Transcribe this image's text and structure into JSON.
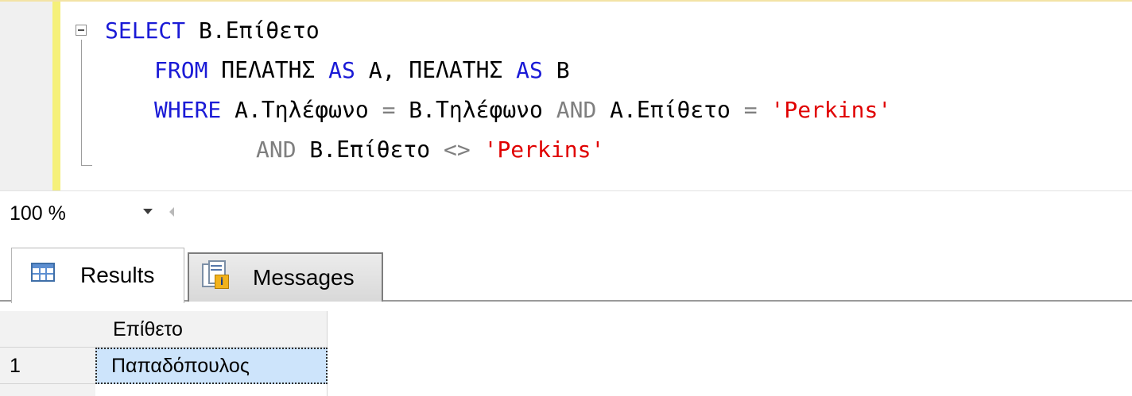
{
  "editor": {
    "lines": [
      [
        {
          "t": "SELECT",
          "c": "kw"
        },
        {
          "t": " B.Επίθετο",
          "c": "id"
        }
      ],
      [
        {
          "t": "FROM",
          "c": "kw"
        },
        {
          "t": " ΠΕΛΑΤΗΣ ",
          "c": "id"
        },
        {
          "t": "AS",
          "c": "kw"
        },
        {
          "t": " A, ΠΕΛΑΤΗΣ ",
          "c": "id"
        },
        {
          "t": "AS",
          "c": "kw"
        },
        {
          "t": " B",
          "c": "id"
        }
      ],
      [
        {
          "t": "WHERE",
          "c": "kw"
        },
        {
          "t": " A.Τηλέφωνο ",
          "c": "id"
        },
        {
          "t": "=",
          "c": "gr"
        },
        {
          "t": " B.Τηλέφωνο ",
          "c": "id"
        },
        {
          "t": "AND",
          "c": "gr"
        },
        {
          "t": " A.Επίθετο ",
          "c": "id"
        },
        {
          "t": "=",
          "c": "gr"
        },
        {
          "t": " ",
          "c": "id"
        },
        {
          "t": "'Perkins'",
          "c": "str"
        }
      ],
      [
        {
          "t": "AND",
          "c": "gr"
        },
        {
          "t": " B.Επίθετο ",
          "c": "id"
        },
        {
          "t": "<>",
          "c": "gr"
        },
        {
          "t": " ",
          "c": "id"
        },
        {
          "t": "'Perkins'",
          "c": "str"
        }
      ]
    ]
  },
  "zoom": {
    "value": "100 %"
  },
  "tabs": [
    {
      "label": "Results",
      "icon": "grid-icon",
      "active": true
    },
    {
      "label": "Messages",
      "icon": "messages-icon",
      "active": false
    }
  ],
  "results": {
    "columns": [
      "Επίθετο"
    ],
    "rows": [
      {
        "num": "1",
        "cells": [
          "Παπαδόπουλος"
        ]
      }
    ]
  }
}
